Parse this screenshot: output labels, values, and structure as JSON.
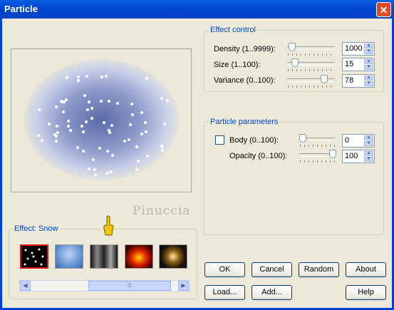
{
  "window": {
    "title": "Particle",
    "close_glyph": "✕"
  },
  "preview": {
    "watermark": "Pinuccia"
  },
  "effect_control": {
    "title": "Effect control",
    "rows": [
      {
        "label": "Density (1..9999):",
        "value": "1000",
        "slider_fraction": 0.1
      },
      {
        "label": "Size (1..100):",
        "value": "15",
        "slider_fraction": 0.14
      },
      {
        "label": "Variance (0..100):",
        "value": "78",
        "slider_fraction": 0.78
      }
    ]
  },
  "particle_parameters": {
    "title": "Particle parameters",
    "body": {
      "label": "Body (0..100):",
      "value": "0",
      "checked": false,
      "slider_fraction": 0.0
    },
    "opacity": {
      "label": "Opacity (0..100):",
      "value": "100",
      "slider_fraction": 1.0
    }
  },
  "effect_select": {
    "title": "Effect: Snow",
    "thumbnails": [
      {
        "name": "snow",
        "selected": true
      },
      {
        "name": "sky",
        "selected": false
      },
      {
        "name": "smoke",
        "selected": false
      },
      {
        "name": "fire",
        "selected": false
      },
      {
        "name": "sparkle",
        "selected": false
      }
    ],
    "scroll_left_glyph": "◀",
    "scroll_right_glyph": "▶",
    "scroll_grip": "|||"
  },
  "buttons": {
    "ok": "OK",
    "cancel": "Cancel",
    "random": "Random",
    "about": "About",
    "load": "Load...",
    "add": "Add...",
    "help": "Help"
  },
  "colors": {
    "title_blue": "#0046D5",
    "group_title": "#0046D5",
    "selection_red": "#DD1111"
  },
  "icons": {
    "spin_up": "▲",
    "spin_down": "▼"
  }
}
